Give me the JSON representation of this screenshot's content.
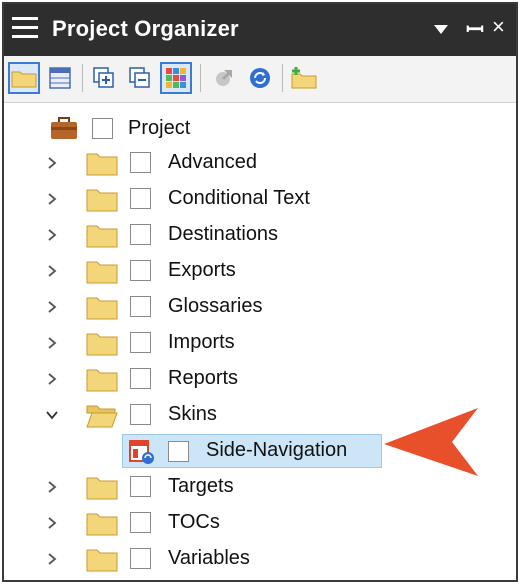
{
  "panel": {
    "title": "Project Organizer",
    "controls": {
      "dropdown": "window-menu",
      "pin": "pin",
      "close": "close"
    }
  },
  "toolbar": {
    "buttons": [
      {
        "name": "open-folder-button",
        "icon": "folder-icon"
      },
      {
        "name": "table-view-button",
        "icon": "table-icon"
      },
      {
        "name": "expand-all-button",
        "icon": "expand-all-icon"
      },
      {
        "name": "collapse-all-button",
        "icon": "collapse-all-icon"
      },
      {
        "name": "color-grid-button",
        "icon": "color-grid-icon",
        "active": true
      },
      {
        "name": "disabled-action-button",
        "icon": "gear-arrow-icon",
        "disabled": true
      },
      {
        "name": "refresh-button",
        "icon": "refresh-icon"
      },
      {
        "name": "new-folder-button",
        "icon": "new-folder-icon"
      }
    ]
  },
  "tree": {
    "root": {
      "label": "Project",
      "icon": "briefcase-icon"
    },
    "items": [
      {
        "label": "Advanced",
        "expanded": false
      },
      {
        "label": "Conditional Text",
        "expanded": false
      },
      {
        "label": "Destinations",
        "expanded": false
      },
      {
        "label": "Exports",
        "expanded": false
      },
      {
        "label": "Glossaries",
        "expanded": false
      },
      {
        "label": "Imports",
        "expanded": false
      },
      {
        "label": "Reports",
        "expanded": false
      },
      {
        "label": "Skins",
        "expanded": true,
        "children": [
          {
            "label": "Side-Navigation",
            "selected": true,
            "icon": "skin-icon"
          }
        ]
      },
      {
        "label": "Targets",
        "expanded": false
      },
      {
        "label": "TOCs",
        "expanded": false
      },
      {
        "label": "Variables",
        "expanded": false
      }
    ]
  },
  "colors": {
    "titlebar": "#2e2e2e",
    "selection": "#cde6f7",
    "arrow": "#e8502c",
    "folder": "#f3d57a"
  }
}
